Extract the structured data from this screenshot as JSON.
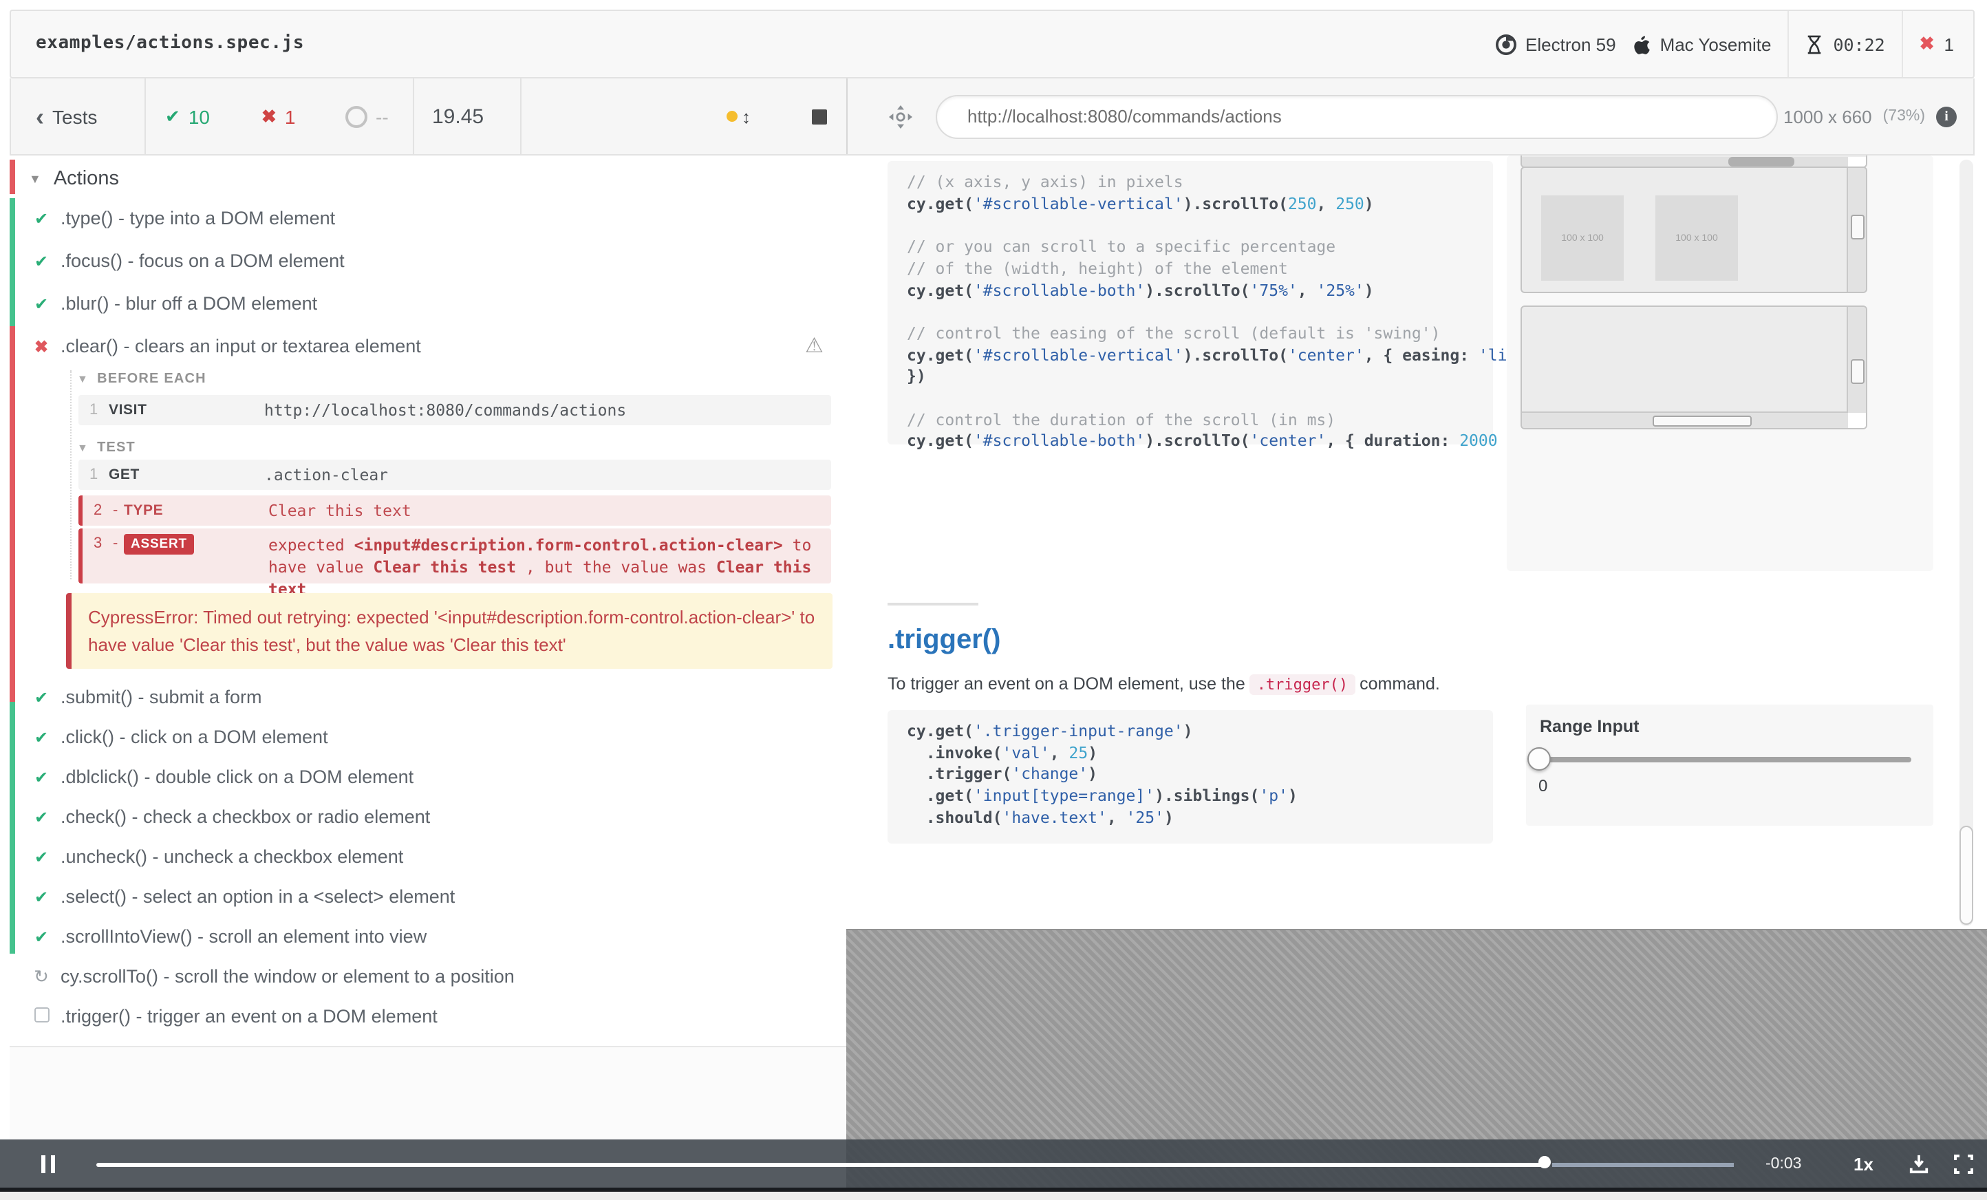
{
  "window": {
    "spec": "examples/actions.spec.js",
    "browser": "Electron 59",
    "os": "Mac Yosemite",
    "timer": "00:22",
    "fail_count": "1"
  },
  "toolbar": {
    "back_label": "Tests",
    "passed": "10",
    "failed": "1",
    "pending": "--",
    "duration": "19.45",
    "url": "http://localhost:8080/commands/actions",
    "viewport_size": "1000 x 660",
    "viewport_scale": "(73%)"
  },
  "reporter": {
    "suite": "Actions",
    "tests_before": [
      {
        "status": "passed",
        "title": ".type() - type into a DOM element"
      },
      {
        "status": "passed",
        "title": ".focus() - focus on a DOM element"
      },
      {
        "status": "passed",
        "title": ".blur() - blur off a DOM element"
      },
      {
        "status": "failed",
        "title": ".clear() - clears an input or textarea element"
      }
    ],
    "hook_before_each": "BEFORE EACH",
    "hook_test": "TEST",
    "commands_before_each": [
      {
        "num": "1",
        "name": "VISIT",
        "msg": "http://localhost:8080/commands/actions",
        "state": "passed"
      }
    ],
    "commands_test": [
      {
        "num": "1",
        "name": "GET",
        "msg": ".action-clear",
        "state": "passed"
      },
      {
        "num": "2",
        "name": "TYPE",
        "dash": "-",
        "msg": "Clear this text",
        "state": "failed"
      }
    ],
    "assert_command": {
      "num": "3",
      "dash": "-",
      "badge": "ASSERT",
      "parts": [
        {
          "bold": false,
          "text": "expected "
        },
        {
          "bold": true,
          "text": "<input#description.form-control.action-clear>"
        },
        {
          "bold": false,
          "text": " to have value "
        },
        {
          "bold": true,
          "text": "Clear this test"
        },
        {
          "bold": false,
          "text": " , but the value was "
        },
        {
          "bold": true,
          "text": "Clear this text"
        }
      ]
    },
    "error": "CypressError: Timed out retrying: expected '<input#description.form-control.action-clear>' to have value 'Clear this test', but the value was 'Clear this text'",
    "tests_after": [
      {
        "status": "passed",
        "title": ".submit() - submit a form"
      },
      {
        "status": "passed",
        "title": ".click() - click on a DOM element"
      },
      {
        "status": "passed",
        "title": ".dblclick() - double click on a DOM element"
      },
      {
        "status": "passed",
        "title": ".check() - check a checkbox or radio element"
      },
      {
        "status": "passed",
        "title": ".uncheck() - uncheck a checkbox element"
      },
      {
        "status": "passed",
        "title": ".select() - select an option in a <select> element"
      },
      {
        "status": "passed",
        "title": ".scrollIntoView() - scroll an element into view"
      },
      {
        "status": "running",
        "title": "cy.scrollTo() - scroll the window or element to a position"
      },
      {
        "status": "pending",
        "title": ".trigger() - trigger an event on a DOM element"
      }
    ]
  },
  "aut": {
    "code1": [
      [
        [
          "c",
          "// (x axis, y axis) in pixels"
        ]
      ],
      [
        [
          "k",
          "cy.get("
        ],
        [
          "s",
          "'#scrollable-vertical'"
        ],
        [
          "k",
          ").scrollTo("
        ],
        [
          "n",
          "250"
        ],
        [
          "k",
          ", "
        ],
        [
          "n",
          "250"
        ],
        [
          "k",
          ")"
        ]
      ],
      [],
      [
        [
          "c",
          "// or you can scroll to a specific percentage"
        ]
      ],
      [
        [
          "c",
          "// of the (width, height) of the element"
        ]
      ],
      [
        [
          "k",
          "cy.get("
        ],
        [
          "s",
          "'#scrollable-both'"
        ],
        [
          "k",
          ").scrollTo("
        ],
        [
          "s",
          "'75%'"
        ],
        [
          "k",
          ", "
        ],
        [
          "s",
          "'25%'"
        ],
        [
          "k",
          ")"
        ]
      ],
      [],
      [
        [
          "c",
          "// control the easing of the scroll (default is 'swing')"
        ]
      ],
      [
        [
          "k",
          "cy.get("
        ],
        [
          "s",
          "'#scrollable-vertical'"
        ],
        [
          "k",
          ").scrollTo("
        ],
        [
          "s",
          "'center'"
        ],
        [
          "k",
          ", { easing: "
        ],
        [
          "s",
          "'linear'"
        ]
      ],
      [
        [
          "k",
          "})"
        ]
      ],
      [],
      [
        [
          "c",
          "// control the duration of the scroll (in ms)"
        ]
      ],
      [
        [
          "k",
          "cy.get("
        ],
        [
          "s",
          "'#scrollable-both'"
        ],
        [
          "k",
          ").scrollTo("
        ],
        [
          "s",
          "'center'"
        ],
        [
          "k",
          ", { duration: "
        ],
        [
          "n",
          "2000"
        ],
        [
          "k",
          " })"
        ]
      ]
    ],
    "trigger_heading": ".trigger()",
    "trigger_para_pre": "To trigger an event on a DOM element, use the ",
    "trigger_para_code": ".trigger()",
    "trigger_para_post": " command.",
    "code2": [
      [
        [
          "k",
          "cy.get("
        ],
        [
          "s",
          "'.trigger-input-range'"
        ],
        [
          "k",
          ")"
        ]
      ],
      [
        [
          "k",
          "  .invoke("
        ],
        [
          "s",
          "'val'"
        ],
        [
          "k",
          ", "
        ],
        [
          "n",
          "25"
        ],
        [
          "k",
          ")"
        ]
      ],
      [
        [
          "k",
          "  .trigger("
        ],
        [
          "s",
          "'change'"
        ],
        [
          "k",
          ")"
        ]
      ],
      [
        [
          "k",
          "  .get("
        ],
        [
          "s",
          "'input[type=range]'"
        ],
        [
          "k",
          ").siblings("
        ],
        [
          "s",
          "'p'"
        ],
        [
          "k",
          ")"
        ]
      ],
      [
        [
          "k",
          "  .should("
        ],
        [
          "s",
          "'have.text'"
        ],
        [
          "k",
          ", "
        ],
        [
          "s",
          "'25'"
        ],
        [
          "k",
          ")"
        ]
      ]
    ],
    "box_label": "100 x 100",
    "range_label": "Range Input",
    "range_value": "0"
  },
  "player": {
    "time_remaining": "-0:03",
    "speed": "1x"
  }
}
